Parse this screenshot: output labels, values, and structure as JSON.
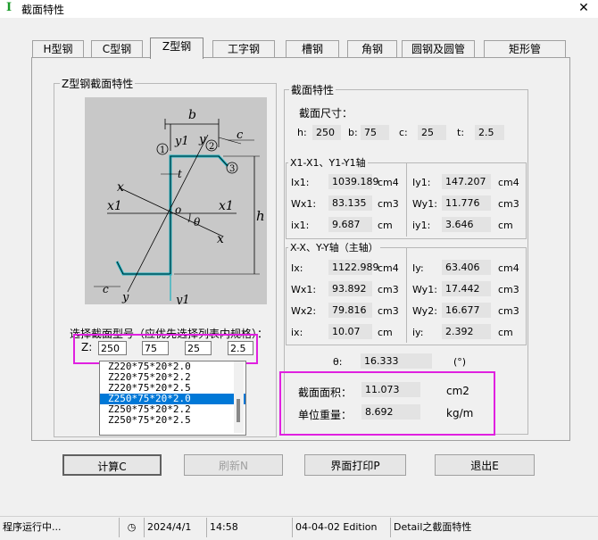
{
  "window": {
    "title": "截面特性",
    "close": "✕"
  },
  "tabs": [
    "H型钢",
    "C型钢",
    "Z型钢",
    "工字钢",
    "槽钢",
    "角钢",
    "圆钢及圆管",
    "矩形管"
  ],
  "diagram": {
    "group_label": "Z型钢截面特性",
    "labels": {
      "b": "b",
      "c": "c",
      "t": "t",
      "h": "h",
      "x": "x",
      "x1": "x1",
      "y": "y",
      "y1": "y1",
      "o": "o",
      "theta": "θ",
      "n1": "1",
      "n2": "2",
      "n3": "3"
    }
  },
  "select": {
    "label": "选择截面型号（应优先选择列表内规格）：",
    "prefix": "Z:",
    "inputs": [
      "250",
      "75",
      "25",
      "2.5"
    ],
    "list": [
      "Z220*75*20*2.0",
      "Z220*75*20*2.2",
      "Z220*75*20*2.5",
      "Z250*75*20*2.0",
      "Z250*75*20*2.2",
      "Z250*75*20*2.5"
    ],
    "selected_index": 3
  },
  "props": {
    "group_label": "截面特性",
    "size_label": "截面尺寸：",
    "dims": [
      {
        "k": "h:",
        "v": "250"
      },
      {
        "k": "b:",
        "v": "75"
      },
      {
        "k": "c:",
        "v": "25"
      },
      {
        "k": "t:",
        "v": "2.5"
      }
    ],
    "axis1_label": "X1-X1、Y1-Y1轴",
    "axis1_left": [
      {
        "k": "Ix1:",
        "v": "1039.189",
        "u": "cm4"
      },
      {
        "k": "Wx1:",
        "v": "83.135",
        "u": "cm3"
      },
      {
        "k": "ix1:",
        "v": "9.687",
        "u": "cm"
      }
    ],
    "axis1_right": [
      {
        "k": "Iy1:",
        "v": "147.207",
        "u": "cm4"
      },
      {
        "k": "Wy1:",
        "v": "11.776",
        "u": "cm3"
      },
      {
        "k": "iy1:",
        "v": "3.646",
        "u": "cm"
      }
    ],
    "axis2_label": "X-X、Y-Y轴（主轴）",
    "axis2_left": [
      {
        "k": "Ix:",
        "v": "1122.989",
        "u": "cm4"
      },
      {
        "k": "Wx1:",
        "v": "93.892",
        "u": "cm3"
      },
      {
        "k": "Wx2:",
        "v": "79.816",
        "u": "cm3"
      },
      {
        "k": "ix:",
        "v": "10.07",
        "u": "cm"
      }
    ],
    "axis2_right": [
      {
        "k": "Iy:",
        "v": "63.406",
        "u": "cm4"
      },
      {
        "k": "Wy1:",
        "v": "17.442",
        "u": "cm3"
      },
      {
        "k": "Wy2:",
        "v": "16.677",
        "u": "cm3"
      },
      {
        "k": "iy:",
        "v": "2.392",
        "u": "cm"
      }
    ],
    "theta": {
      "k": "θ:",
      "v": "16.333",
      "u": "(°)"
    },
    "area": {
      "k": "截面面积：",
      "v": "11.073",
      "u": "cm2"
    },
    "weight": {
      "k": "单位重量：",
      "v": "8.692",
      "u": "kg/m"
    }
  },
  "buttons": [
    "计算C",
    "刷新N",
    "界面打印P",
    "退出E"
  ],
  "status": [
    "程序运行中...",
    "2024/4/1",
    "14:58",
    "04-04-02 Edition",
    "Detail之截面特性"
  ],
  "colors": {
    "highlight": "#e020e0",
    "selection": "#0078d7",
    "section_line": "#1ab0c0"
  }
}
